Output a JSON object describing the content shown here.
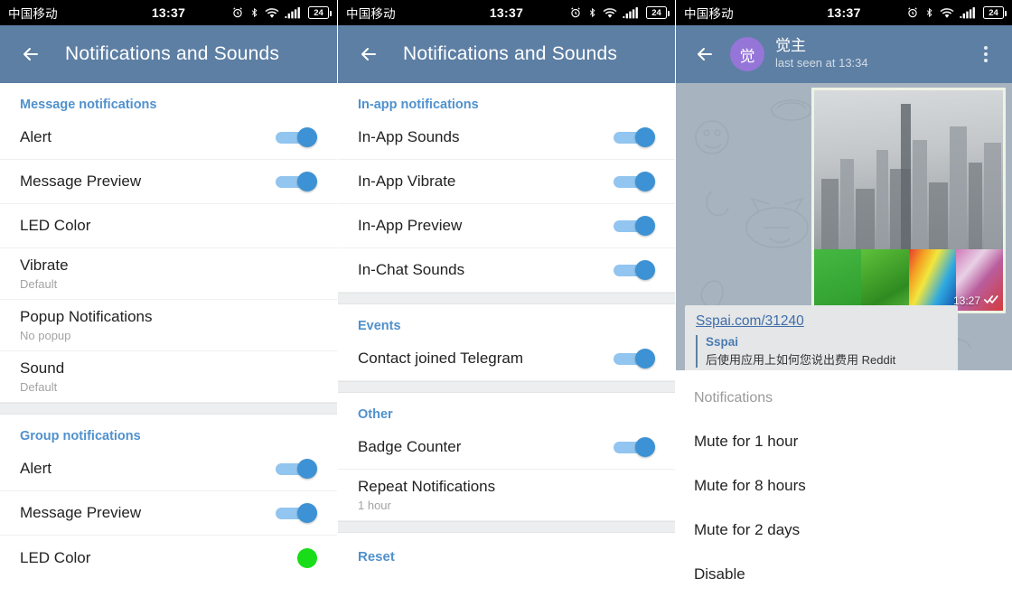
{
  "statusbar": {
    "carrier": "中国移动",
    "time": "13:37",
    "battery": "24",
    "icons": [
      "alarm-icon",
      "bluetooth-icon",
      "wifi-icon",
      "signal-icon",
      "battery-icon"
    ]
  },
  "screen1": {
    "appbar": {
      "title": "Notifications and Sounds",
      "back": "back-arrow-icon"
    },
    "sections": [
      {
        "title": "Message notifications",
        "rows": [
          {
            "label": "Alert",
            "sub": "",
            "control": "toggle",
            "on": true
          },
          {
            "label": "Message Preview",
            "sub": "",
            "control": "toggle",
            "on": true
          },
          {
            "label": "LED Color",
            "sub": "",
            "control": "none"
          },
          {
            "label": "Vibrate",
            "sub": "Default",
            "control": "none"
          },
          {
            "label": "Popup Notifications",
            "sub": "No popup",
            "control": "none"
          },
          {
            "label": "Sound",
            "sub": "Default",
            "control": "none"
          }
        ]
      },
      {
        "title": "Group notifications",
        "rows": [
          {
            "label": "Alert",
            "sub": "",
            "control": "toggle",
            "on": true
          },
          {
            "label": "Message Preview",
            "sub": "",
            "control": "toggle",
            "on": true
          },
          {
            "label": "LED Color",
            "sub": "",
            "control": "color-dot",
            "color": "#18dd18"
          }
        ]
      }
    ]
  },
  "screen2": {
    "appbar": {
      "title": "Notifications and Sounds",
      "back": "back-arrow-icon"
    },
    "sections": [
      {
        "title": "In-app notifications",
        "rows": [
          {
            "label": "In-App Sounds",
            "sub": "",
            "control": "toggle",
            "on": true
          },
          {
            "label": "In-App Vibrate",
            "sub": "",
            "control": "toggle",
            "on": true
          },
          {
            "label": "In-App Preview",
            "sub": "",
            "control": "toggle",
            "on": true
          },
          {
            "label": "In-Chat Sounds",
            "sub": "",
            "control": "toggle",
            "on": true
          }
        ]
      },
      {
        "title": "Events",
        "rows": [
          {
            "label": "Contact joined Telegram",
            "sub": "",
            "control": "toggle",
            "on": true
          }
        ]
      },
      {
        "title": "Other",
        "rows": [
          {
            "label": "Badge Counter",
            "sub": "",
            "control": "toggle",
            "on": true
          },
          {
            "label": "Repeat Notifications",
            "sub": "1 hour",
            "control": "none"
          }
        ]
      }
    ],
    "reset_label": "Reset"
  },
  "screen3": {
    "appbar": {
      "back": "back-arrow-icon",
      "avatar_letter": "觉",
      "name": "觉主",
      "status": "last seen at 13:34",
      "overflow": "more-options-icon"
    },
    "message": {
      "time": "13:27",
      "read_receipt": "double-check-icon"
    },
    "link_preview": {
      "url": "Sspai.com/31240",
      "site": "Sspai",
      "description": "后使用应用上如何您说出费用 Reddit"
    },
    "menu": {
      "title": "Notifications",
      "items": [
        "Mute for 1 hour",
        "Mute for 8 hours",
        "Mute for 2 days",
        "Disable"
      ]
    }
  },
  "colors": {
    "appbar": "#5d7fa4",
    "section_title": "#5091cd",
    "toggle_knob": "#3c92d4",
    "toggle_track": "#92c5ef",
    "led_green": "#18dd18",
    "avatar": "#9675d8"
  }
}
